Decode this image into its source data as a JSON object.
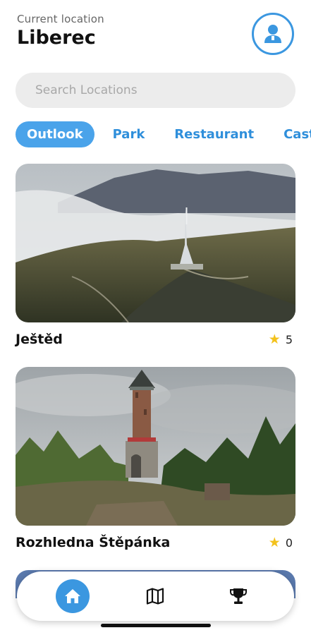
{
  "header": {
    "location_label": "Current location",
    "location_name": "Liberec",
    "profile_icon": "user-icon"
  },
  "search": {
    "placeholder": "Search Locations",
    "value": ""
  },
  "categories": [
    {
      "label": "Outlook",
      "active": true
    },
    {
      "label": "Park",
      "active": false
    },
    {
      "label": "Restaurant",
      "active": false
    },
    {
      "label": "Castle",
      "active": false
    }
  ],
  "places": [
    {
      "name": "Ještěd",
      "rating": "5"
    },
    {
      "name": "Rozhledna Štěpánka",
      "rating": "0"
    }
  ],
  "bottom_nav": [
    {
      "icon": "home-icon",
      "active": true
    },
    {
      "icon": "map-icon",
      "active": false
    },
    {
      "icon": "trophy-icon",
      "active": false
    }
  ],
  "colors": {
    "accent": "#3b97e0",
    "tab_active_bg": "#4aa3ea",
    "star": "#f3c21c",
    "search_bg": "#ececec"
  }
}
